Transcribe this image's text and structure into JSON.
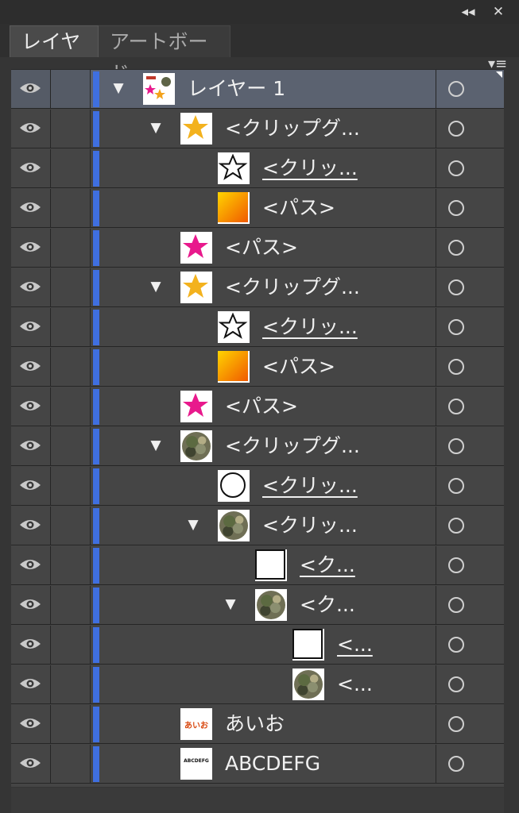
{
  "window": {
    "collapse_icon": "◂◂",
    "close_icon": "✕"
  },
  "tabs": [
    {
      "label": "レイヤー",
      "active": true
    },
    {
      "label": "アートボード",
      "active": false
    }
  ],
  "panel_menu_icon": "▾≡",
  "rows": [
    {
      "label": "レイヤー 1",
      "underline": false,
      "expanded": true,
      "thumb": "layer"
    },
    {
      "label": "<クリップグ...",
      "underline": false,
      "expanded": true,
      "thumb": "star-orange"
    },
    {
      "label": "<クリッ...",
      "underline": true,
      "expanded": null,
      "thumb": "star-outline"
    },
    {
      "label": "<パス>",
      "underline": false,
      "expanded": null,
      "thumb": "gradient"
    },
    {
      "label": "<パス>",
      "underline": false,
      "expanded": null,
      "thumb": "star-pink"
    },
    {
      "label": "<クリップグ...",
      "underline": false,
      "expanded": true,
      "thumb": "star-orange"
    },
    {
      "label": "<クリッ...",
      "underline": true,
      "expanded": null,
      "thumb": "star-outline"
    },
    {
      "label": "<パス>",
      "underline": false,
      "expanded": null,
      "thumb": "gradient"
    },
    {
      "label": "<パス>",
      "underline": false,
      "expanded": null,
      "thumb": "star-pink"
    },
    {
      "label": "<クリップグ...",
      "underline": false,
      "expanded": true,
      "thumb": "camo"
    },
    {
      "label": "<クリッ...",
      "underline": true,
      "expanded": null,
      "thumb": "circle-outline"
    },
    {
      "label": "<クリッ...",
      "underline": false,
      "expanded": true,
      "thumb": "camo"
    },
    {
      "label": "<ク...",
      "underline": true,
      "expanded": null,
      "thumb": "white-square"
    },
    {
      "label": "<ク...",
      "underline": false,
      "expanded": true,
      "thumb": "camo"
    },
    {
      "label": "<...",
      "underline": true,
      "expanded": null,
      "thumb": "white-square"
    },
    {
      "label": "<...",
      "underline": false,
      "expanded": null,
      "thumb": "camo"
    },
    {
      "label": "あいお",
      "underline": false,
      "expanded": null,
      "thumb": "text-aio",
      "thumb_text": "あいお"
    },
    {
      "label": "ABCDEFG",
      "underline": false,
      "expanded": null,
      "thumb": "text-abc",
      "thumb_text": "ABCDEFG"
    }
  ],
  "colors": {
    "layer_color": "#3f6fe0",
    "selected_row": "#5b6270",
    "panel_bg": "#454545"
  }
}
